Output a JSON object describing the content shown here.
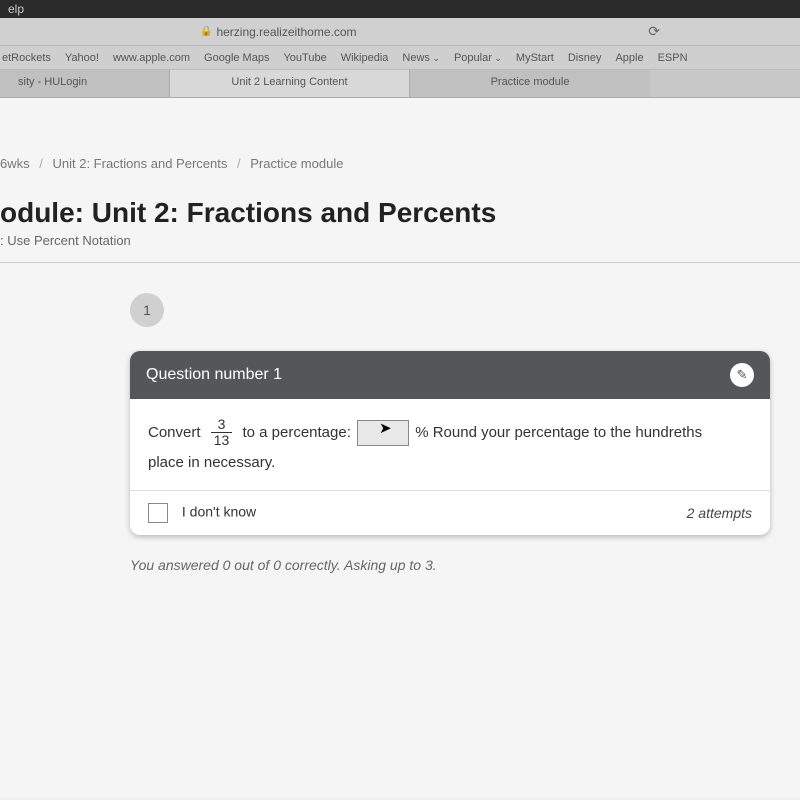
{
  "menubar": {
    "help": "elp"
  },
  "address": {
    "url": "herzing.realizeithome.com"
  },
  "bookmarks": {
    "items": [
      "etRockets",
      "Yahoo!",
      "www.apple.com",
      "Google Maps",
      "YouTube",
      "Wikipedia",
      "News",
      "Popular",
      "MyStart",
      "Disney",
      "Apple",
      "ESPN"
    ]
  },
  "tabs": {
    "items": [
      "sity - HULogin",
      "Unit 2 Learning Content",
      "Practice module"
    ]
  },
  "breadcrumb": {
    "items": [
      "6wks",
      "Unit 2: Fractions and Percents",
      "Practice module"
    ]
  },
  "page": {
    "title": "odule: Unit 2: Fractions and Percents",
    "subtitle": ": Use Percent Notation"
  },
  "question": {
    "number": "1",
    "header": "Question number 1",
    "text_before": "Convert",
    "fraction_num": "3",
    "fraction_den": "13",
    "text_mid": "to a percentage:",
    "text_after1": "% Round your percentage to the hundreths",
    "text_after2": "place in necessary.",
    "dont_know": "I don't know",
    "attempts": "2 attempts",
    "answer_value": ""
  },
  "status": {
    "line": "You answered 0 out of 0 correctly. Asking up to 3."
  }
}
